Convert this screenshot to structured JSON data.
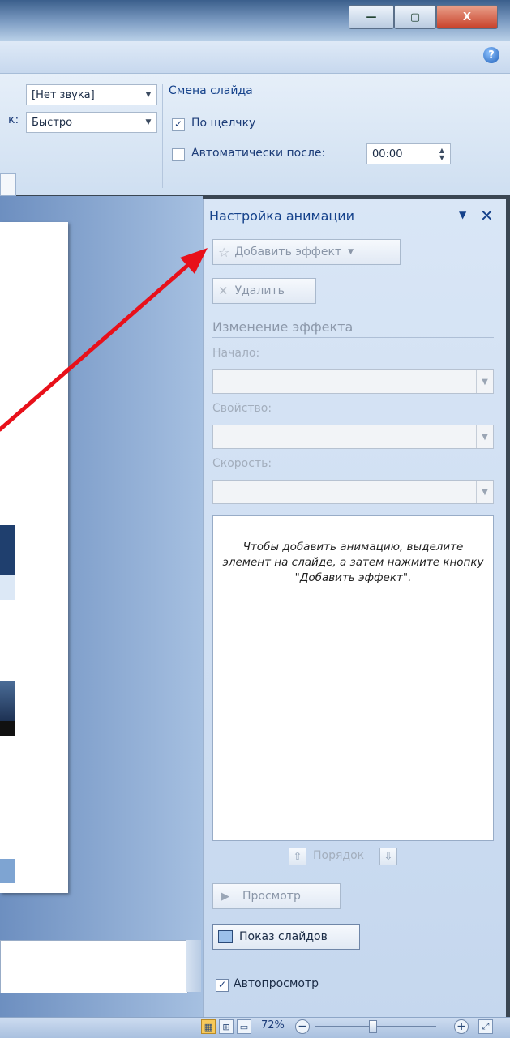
{
  "ribbon": {
    "sound_value": "[Нет звука]",
    "speed_label_fragment": "к:",
    "speed_value": "Быстро",
    "group_title": "Смена слайда",
    "on_click_label": "По щелчку",
    "on_click_checked": "✓",
    "auto_after_label": "Автоматически после:",
    "auto_after_value": "00:00",
    "help_icon": "?"
  },
  "window": {
    "minimize_glyph": "—",
    "maximize_glyph": "▢",
    "close_glyph": "X"
  },
  "pane": {
    "title": "Настройка анимации",
    "dropdown_glyph": "▼",
    "close_glyph": "✕",
    "add_effect_label": "Добавить эффект",
    "remove_label": "Удалить",
    "section_title": "Изменение эффекта",
    "start_label": "Начало:",
    "property_label": "Свойство:",
    "speed_label": "Скорость:",
    "hint": "Чтобы добавить анимацию, выделите элемент на слайде, а затем нажмите кнопку \"Добавить эффект\".",
    "order_label": "Порядок",
    "preview_label": "Просмотр",
    "slideshow_label": "Показ слайдов",
    "autopreview_label": "Автопросмотр",
    "autopreview_checked": "✓"
  },
  "statusbar": {
    "zoom_value": "72%",
    "zoom_minus": "−",
    "zoom_plus": "+"
  },
  "colors": {
    "annotation_arrow": "#e8101a",
    "ribbon_text": "#15428b"
  }
}
